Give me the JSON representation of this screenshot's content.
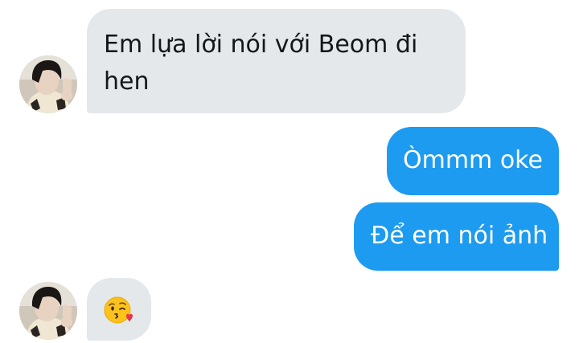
{
  "conversation": {
    "messages": [
      {
        "direction": "incoming",
        "text": "Em lựa lời nói với Beom đi hen"
      },
      {
        "direction": "outgoing",
        "text": "Òmmm oke"
      },
      {
        "direction": "outgoing",
        "text": "Để em nói ảnh"
      },
      {
        "direction": "incoming",
        "emoji": "face-blowing-kiss-emoji"
      }
    ]
  },
  "colors": {
    "incoming_bubble": "#e4e8eb",
    "outgoing_bubble": "#1d9bf0",
    "incoming_text": "#14171a",
    "outgoing_text": "#ffffff"
  }
}
